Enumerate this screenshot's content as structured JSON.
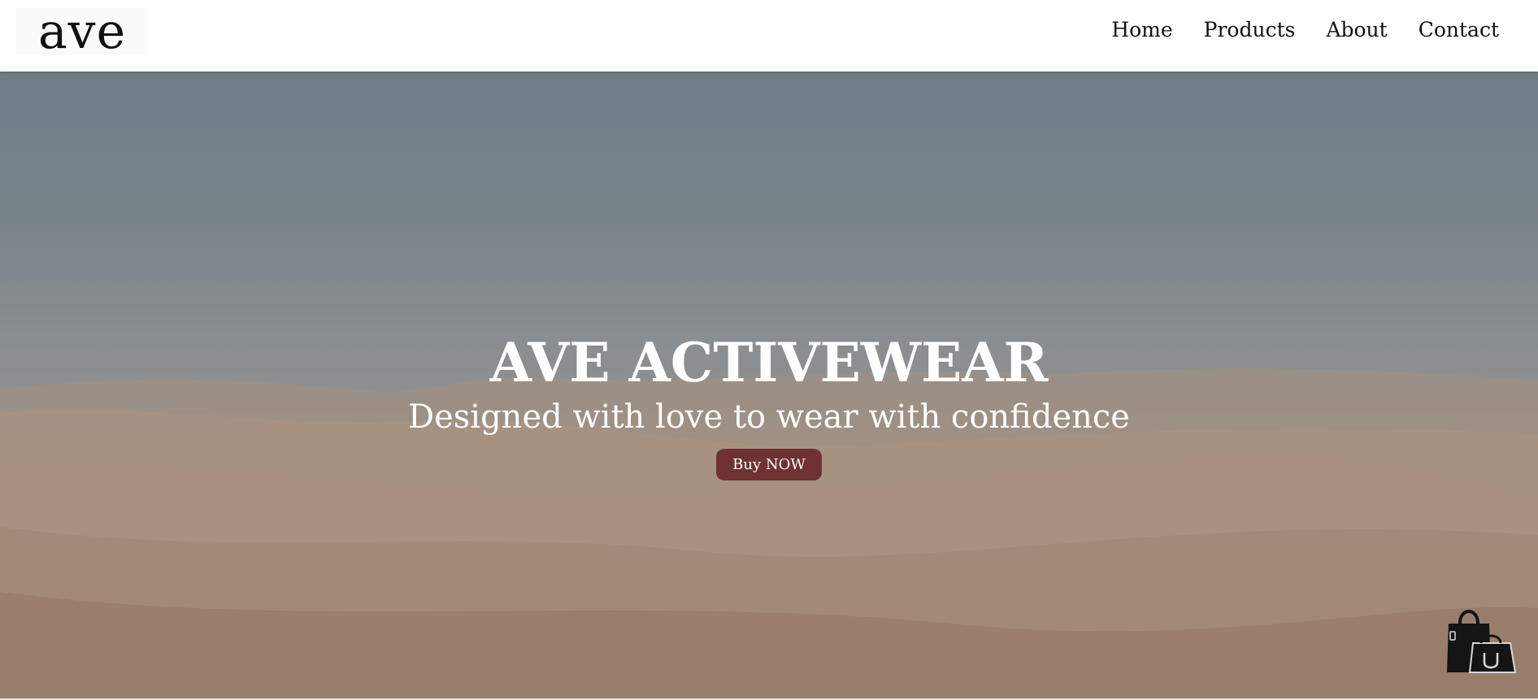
{
  "header": {
    "logo_text": "ave",
    "nav": [
      {
        "label": "Home"
      },
      {
        "label": "Products"
      },
      {
        "label": "About"
      },
      {
        "label": "Contact"
      }
    ]
  },
  "hero": {
    "title": "AVE ACTIVEWEAR",
    "subtitle": "Designed with love to wear with confidence",
    "cta_label": "Buy NOW",
    "cta_color": "#6e3232"
  },
  "icons": {
    "cart": "shopping-bags-icon"
  }
}
